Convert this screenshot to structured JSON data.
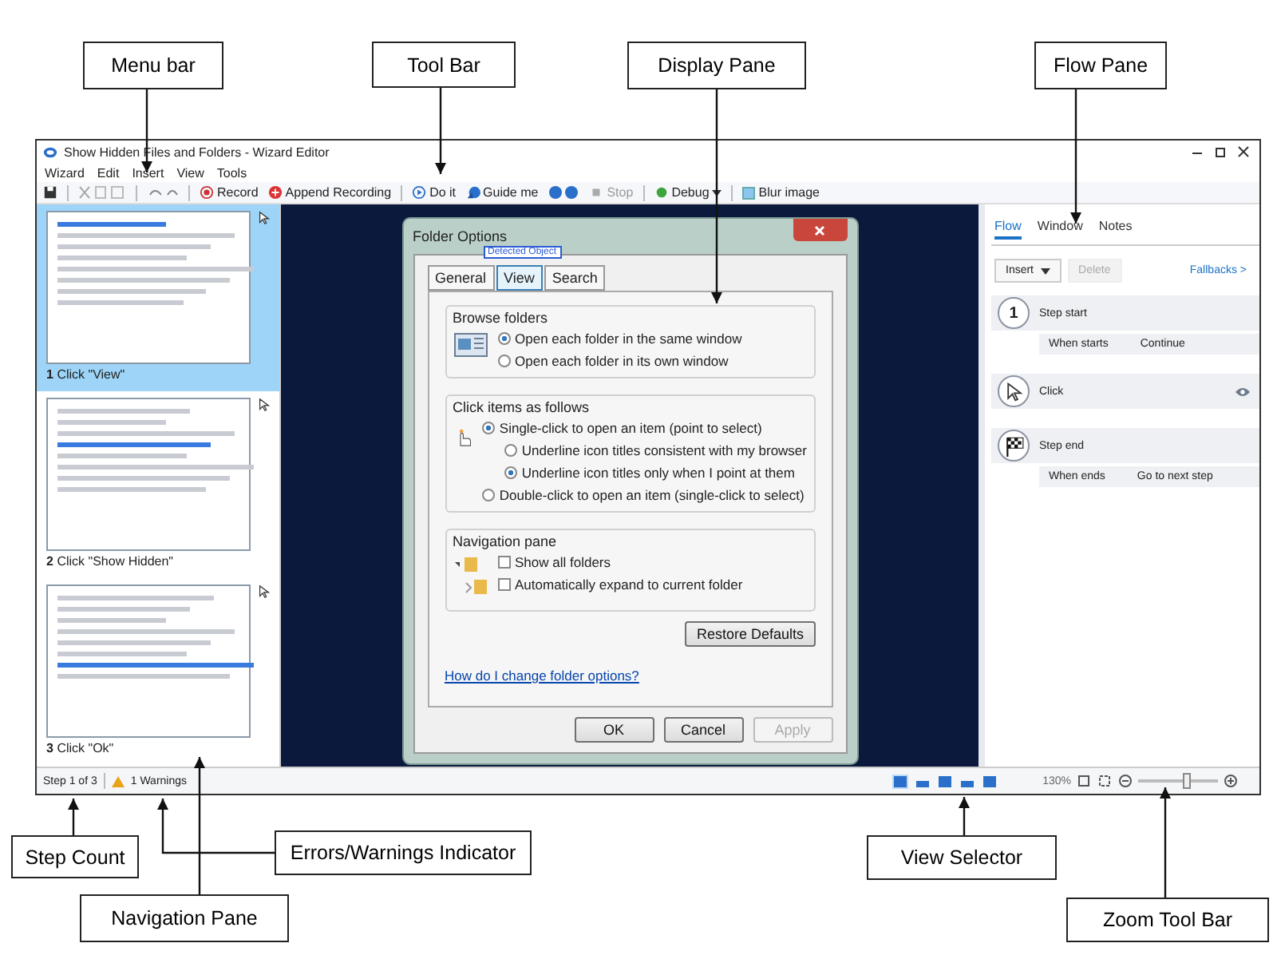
{
  "callouts": [
    {
      "label": "Menu bar"
    },
    {
      "label": "Tool Bar"
    },
    {
      "label": "Display Pane"
    },
    {
      "label": "Flow Pane"
    },
    {
      "label": "Step Count"
    },
    {
      "label": "Errors/Warnings Indicator"
    },
    {
      "label": "Navigation Pane"
    },
    {
      "label": "View Selector"
    },
    {
      "label": "Zoom Tool Bar"
    }
  ],
  "window": {
    "title": "Show Hidden Files and Folders - Wizard Editor"
  },
  "menu": [
    "Wizard",
    "Edit",
    "Insert",
    "View",
    "Tools"
  ],
  "toolbar": [
    {
      "kind": "record",
      "label": "Record",
      "disabled": false
    },
    {
      "kind": "append",
      "label": "Append Recording",
      "disabled": false
    },
    {
      "kind": "play",
      "label": "Do it",
      "disabled": false
    },
    {
      "kind": "guide",
      "label": "Guide me",
      "disabled": false
    },
    {
      "kind": "stop",
      "label": "Stop",
      "disabled": true
    },
    {
      "kind": "debug",
      "label": "Debug",
      "disabled": false
    }
  ],
  "blur_image": {
    "label": "Blur image",
    "checked": false
  },
  "steps": [
    {
      "number": "1",
      "caption": "Click \"View\"",
      "selected": true
    },
    {
      "number": "2",
      "caption": "Click \"Show Hidden\"",
      "selected": false
    },
    {
      "number": "3",
      "caption": "Click \"Ok\"",
      "selected": false
    }
  ],
  "dialog": {
    "title": "Folder Options",
    "detected_label": "Detected Object",
    "tabs": [
      {
        "label": "General",
        "selected": false
      },
      {
        "label": "View",
        "selected": true
      },
      {
        "label": "Search",
        "selected": false
      }
    ],
    "groups": [
      {
        "title": "Browse folders",
        "kind": "browse",
        "options": [
          {
            "kind": "radio",
            "label": "Open each folder in the same window",
            "selected": true
          },
          {
            "kind": "radio",
            "label": "Open each folder in its own window",
            "selected": false
          }
        ]
      },
      {
        "title": "Click items as follows",
        "kind": "click",
        "options": [
          {
            "kind": "radio",
            "label": "Single-click to open an item (point to select)",
            "selected": true,
            "children": [
              {
                "kind": "radio",
                "label": "Underline icon titles consistent with my browser",
                "selected": false
              },
              {
                "kind": "radio",
                "label": "Underline icon titles only when I point at them",
                "selected": true
              }
            ]
          },
          {
            "kind": "radio",
            "label": "Double-click to open an item (single-click to select)",
            "selected": false
          }
        ]
      },
      {
        "title": "Navigation pane",
        "kind": "nav",
        "options": [
          {
            "kind": "checkbox",
            "label": "Show all folders",
            "selected": false
          },
          {
            "kind": "checkbox",
            "label": "Automatically expand to current folder",
            "selected": false
          }
        ]
      }
    ],
    "restore_button": "Restore Defaults",
    "help_link": "How do I change folder options?",
    "buttons": [
      {
        "label": "OK",
        "disabled": false
      },
      {
        "label": "Cancel",
        "disabled": false
      },
      {
        "label": "Apply",
        "disabled": true
      }
    ]
  },
  "flow": {
    "tabs": [
      {
        "label": "Flow",
        "selected": true
      },
      {
        "label": "Window",
        "selected": false
      },
      {
        "label": "Notes",
        "selected": false
      }
    ],
    "insert_button": "Insert",
    "delete_button": "Delete",
    "fallbacks_link": "Fallbacks >",
    "items": [
      {
        "kind": "start",
        "badge": "1",
        "title": "Step start",
        "property": "When starts",
        "value": "Continue"
      },
      {
        "kind": "click",
        "title": "Click"
      },
      {
        "kind": "end",
        "title": "Step end",
        "property": "When ends",
        "value": "Go to next step"
      }
    ]
  },
  "status_bar": {
    "step_count": "Step 1 of 3",
    "warnings": "1 Warnings",
    "views": [
      {
        "selected": true
      },
      {
        "selected": false
      },
      {
        "selected": false
      },
      {
        "selected": false
      },
      {
        "selected": false
      }
    ],
    "zoom": {
      "reading": "130%",
      "level": 0.6
    }
  }
}
